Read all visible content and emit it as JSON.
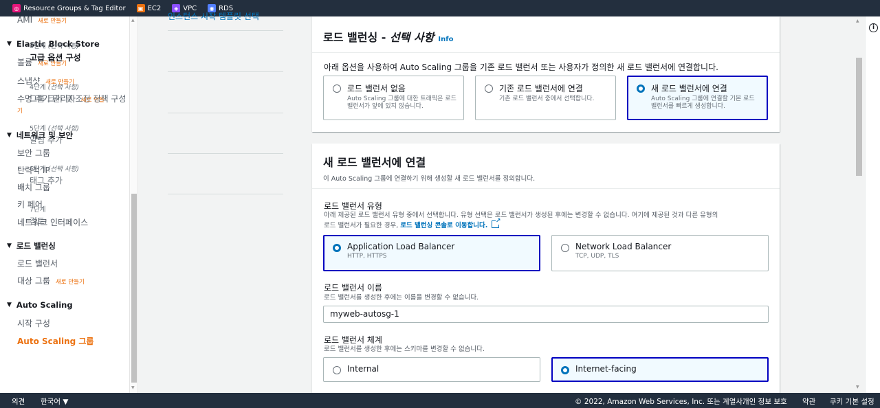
{
  "topbar": {
    "items": [
      {
        "label": "Resource Groups & Tag Editor",
        "icon": "resource-groups-icon",
        "color": "#e7157b"
      },
      {
        "label": "EC2",
        "icon": "ec2-icon",
        "color": "#ec7211"
      },
      {
        "label": "VPC",
        "icon": "vpc-icon",
        "color": "#8c4fff"
      },
      {
        "label": "RDS",
        "icon": "rds-icon",
        "color": "#527fff"
      }
    ]
  },
  "sidebar": {
    "ami": {
      "label": "AMI",
      "new": "새로 만들기"
    },
    "ebs": {
      "title": "Elastic Block Store",
      "items": [
        {
          "label": "볼륨",
          "new": "새로 만들기"
        },
        {
          "label": "스냅샷",
          "new": "새로 만들기"
        },
        {
          "label": "수명 주기 관리자",
          "new": "새로 만들",
          "new2": "기"
        }
      ]
    },
    "network": {
      "title": "네트워크 및 보안",
      "items": [
        "보안 그룹",
        "탄력적 IP",
        "배치 그룹",
        "키 페어",
        "네트워크 인터페이스"
      ]
    },
    "lb": {
      "title": "로드 밸런싱",
      "items": [
        {
          "label": "로드 밸런서"
        },
        {
          "label": "대상 그룹",
          "new": "새로 만들기"
        }
      ]
    },
    "asg": {
      "title": "Auto Scaling",
      "items": [
        "시작 구성",
        "Auto Scaling 그룹"
      ]
    }
  },
  "steps": {
    "partial_top": "인스턴스 시작 템플릿 선택",
    "items": [
      {
        "num": "3단계",
        "opt": "(선택 사항)",
        "title": "고급 옵션 구성"
      },
      {
        "num": "4단계",
        "opt": "(선택 사항)",
        "title": "그룹 크기 및 조정 정책 구성"
      },
      {
        "num": "5단계",
        "opt": "(선택 사항)",
        "title": "알림 추가"
      },
      {
        "num": "6단계",
        "opt": "(선택 사항)",
        "title": "태그 추가"
      },
      {
        "num": "7단계",
        "opt": "",
        "title": "검토"
      }
    ]
  },
  "lb_card": {
    "title": "로드 밸런싱 - ",
    "title_italic": "선택 사항",
    "info": "Info",
    "desc": "아래 옵션을 사용하여 Auto Scaling 그룹을 기존 로드 밸런서 또는 사용자가 정의한 새 로드 밸런서에 연결합니다.",
    "options": [
      {
        "title": "로드 밸런서 없음",
        "desc": "Auto Scaling 그룹에 대한 트래픽은 로드 밸런서가 앞에 있지 않습니다."
      },
      {
        "title": "기존 로드 밸런서에 연결",
        "desc": "기존 로드 밸런서 중에서 선택합니다."
      },
      {
        "title": "새 로드 밸런서에 연결",
        "desc": "Auto Scaling 그룹에 연결할 기본 로드 밸런서를 빠르게 생성합니다."
      }
    ],
    "selected": 2
  },
  "new_lb_card": {
    "title": "새 로드 밸런서에 연결",
    "desc": "이 Auto Scaling 그룹에 연결하기 위해 생성할 새 로드 밸런서를 정의합니다.",
    "type": {
      "label": "로드 밸런서 유형",
      "desc": "아래 제공된 로드 밸런서 유형 중에서 선택합니다. 유형 선택은 로드 밸런서가 생성된 후에는 변경할 수 없습니다. 여기에 제공된 것과 다른 유형의",
      "desc2": "로드 밸런서가 필요한 경우, ",
      "link": "로드 밸런싱 콘솔로 이동합니다.",
      "options": [
        {
          "title": "Application Load Balancer",
          "desc": "HTTP, HTTPS"
        },
        {
          "title": "Network Load Balancer",
          "desc": "TCP, UDP, TLS"
        }
      ],
      "selected": 0
    },
    "name": {
      "label": "로드 밸런서 이름",
      "desc": "로드 밸런서를 생성한 후에는 이름을 변경할 수 없습니다.",
      "value": "myweb-autosg-1"
    },
    "scheme": {
      "label": "로드 밸런서 체계",
      "desc": "로드 밸런서를 생성한 후에는 스키마를 변경할 수 없습니다.",
      "options": [
        "Internal",
        "Internet-facing"
      ],
      "selected": 1
    }
  },
  "footer": {
    "feedback": "의견",
    "language": "한국어 ▼",
    "copyright": "© 2022, Amazon Web Services, Inc. 또는 계열사.",
    "privacy": "개인 정보 보호",
    "terms": "약관",
    "cookies": "쿠키 기본 설정"
  },
  "colors": {
    "accent": "#ec7211",
    "link": "#0073bb",
    "selected_border": "#0000c0",
    "nav_bg": "#232f3e"
  }
}
